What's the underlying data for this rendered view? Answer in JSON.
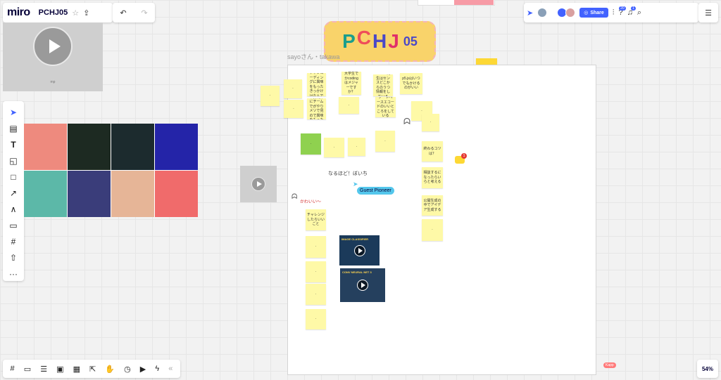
{
  "app": {
    "logo": "miro",
    "board_name": "PCHJ05"
  },
  "icons": {
    "star": "☆",
    "export": "⇪",
    "undo": "↶",
    "redo": "↷",
    "list": "☰"
  },
  "left_video": {
    "caption": "mp"
  },
  "toolbar": {
    "items": [
      "select-icon",
      "template-icon",
      "text-icon",
      "sticky-note-icon",
      "shape-icon",
      "arrow-icon",
      "pen-icon",
      "comment-icon",
      "frame-icon",
      "upload-icon",
      "more-icon"
    ]
  },
  "tiles": {
    "colors": [
      "#ee8a7e",
      "#1d2a22",
      "#1c2b2e",
      "#2424a8",
      "#5cb8a8",
      "#3a3d7a",
      "#e6b597",
      "#f06b6b"
    ]
  },
  "banner": {
    "letters": [
      "P",
      "C",
      "H",
      "J"
    ],
    "number": "05",
    "letter_colors": [
      "#1a9e8c",
      "#ef4d5a",
      "#4a48c8",
      "#e0306a"
    ]
  },
  "frame": {
    "label": "sayoさん・takawa"
  },
  "stickies": [
    {
      "text": "クリエイティブコーディングに興味をもったきっかけはなんですか？"
    },
    {
      "text": "大学生でかcodingはメジャーですか？"
    },
    {
      "text": "takawa先生はセンスどこからのうつ情報をしている"
    },
    {
      "text": "p5.jsはいつでもかけるのがいい"
    },
    {
      "text": "卒業制作にチームでがやりメソで見ので興味をもった"
    },
    {
      "text": "ノードベースエコードのいいところをしている"
    },
    {
      "text": "終わるコツは？"
    },
    {
      "text": "相談するになったらいらと考える"
    },
    {
      "text": "公開生成の中でアイデア生成する"
    },
    {
      "text": "チャレンジしたらいいこと"
    }
  ],
  "handwriting": {
    "note1": "なるほど！ぼいち",
    "note2": "かわいい〜"
  },
  "cursor": {
    "guest": "Guest Pioneer",
    "kapp": "Kapp"
  },
  "videos": {
    "v1_title": "IMAGE CLASSIFIER",
    "v2_title": "CONV NEURAL NET 3"
  },
  "topbar": {
    "share": "Share",
    "help_badge": "20",
    "bell_badge": "1"
  },
  "comment_badge": "1",
  "zoom": "54%"
}
